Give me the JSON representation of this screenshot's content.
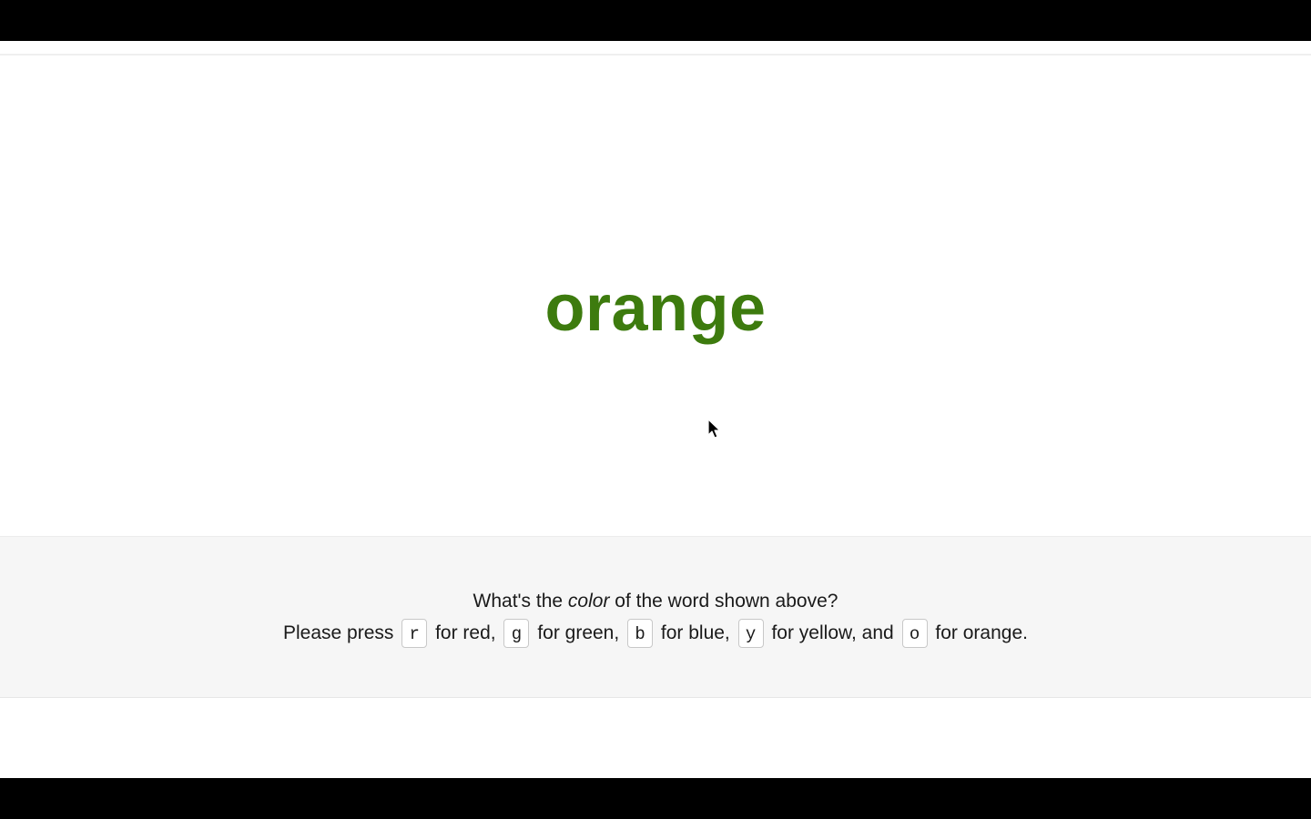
{
  "stimulus": {
    "word": "orange",
    "ink_color": "#3d7b0e"
  },
  "instructions": {
    "question_before": "What's the ",
    "question_emphasis": "color",
    "question_after": " of the word shown above?",
    "press_prefix": "Please press",
    "keys": [
      {
        "key": "r",
        "label": "for red,"
      },
      {
        "key": "g",
        "label": "for green,"
      },
      {
        "key": "b",
        "label": "for blue,"
      },
      {
        "key": "y",
        "label": "for yellow, and"
      },
      {
        "key": "o",
        "label": "for orange."
      }
    ]
  },
  "colors": {
    "panel_background": "#f6f6f6",
    "page_background": "#ffffff",
    "letterbox": "#000000"
  },
  "icons": {
    "cursor": "mouse-pointer-icon"
  }
}
